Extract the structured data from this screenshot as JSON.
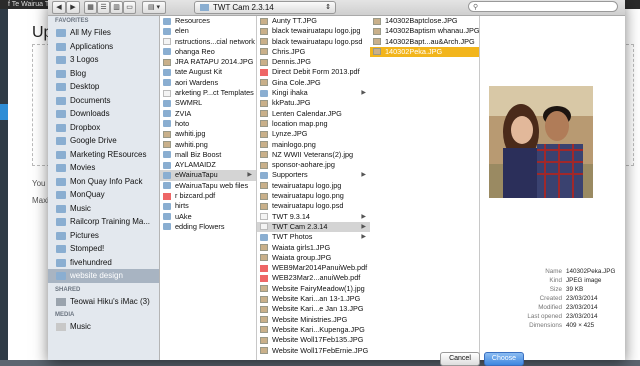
{
  "background": {
    "header": "f Te Wairua Ta",
    "title": "Up",
    "line1": "You a",
    "line2": "Maxi"
  },
  "toolbar": {
    "path_label": "TWT Cam 2.3.14",
    "search_placeholder": ""
  },
  "sidebar": {
    "favorites_header": "FAVORITES",
    "favorites": [
      "All My Files",
      "Applications",
      "3 Logos",
      "Blog",
      "Desktop",
      "Documents",
      "Downloads",
      "Dropbox",
      "Google Drive",
      "Marketing REsources",
      "Movies",
      "Mon Quay Info Pack",
      "MonQuay",
      "Music",
      "Railcorp Training Ma...",
      "Pictures",
      "Stomped!",
      "fivehundred",
      "website design"
    ],
    "shared_header": "SHARED",
    "shared": [
      "Teowai Hiku's iMac (3)"
    ],
    "media_header": "MEDIA",
    "media": [
      "Music"
    ]
  },
  "col1": [
    "Resources",
    "elen",
    "nstructions...cial network",
    "ohanga Reo",
    "JRA RATAPU 2014.JPG",
    "tate August Kit",
    "aori Wardens",
    "arketing P...ct Templates",
    "SWMRL",
    "ZVIA",
    "hoto",
    "awhiti.jpg",
    "awhiti.png",
    "mall Biz Boost",
    "AYLAMAIDZ",
    "eWairuaTapu",
    "eWairuaTapu web files",
    "r bizcard.pdf",
    "hirts",
    "uAke",
    "edding Flowers"
  ],
  "col2": [
    "Aunty TT.JPG",
    "black tewairuatapu logo.jpg",
    "black tewairuatapu logo.psd",
    "Chris.JPG",
    "Dennis.JPG",
    "Direct Debit Form 2013.pdf",
    "Gina Cole.JPG",
    "Kingi ihaka",
    "kkPatu.JPG",
    "Lenten Calendar.JPG",
    "location map.png",
    "Lynze.JPG",
    "mainlogo.png",
    "NZ WWII Veterans(2).jpg",
    "sponsor-aohare.jpg",
    "Supporters",
    "tewairuatapu logo.jpg",
    "tewairuatapu logo.png",
    "tewairuatapu logo.psd",
    "TWT 9.3.14",
    "TWT Cam 2.3.14",
    "TWT Photos",
    "Waiata girls1.JPG",
    "Waiata group.JPG",
    "WEB9Mar2014PanuiWeb.pdf",
    "WEB23Mar2...anuiWeb.pdf",
    "Website FairyMeadow(1).jpg",
    "Website Kari...an 13-1.JPG",
    "Website Kari...e Jan 13.JPG",
    "Website Ministries.JPG",
    "Website Kari...Kupenga.JPG",
    "Website Woll17Feb135.JPG",
    "Website Woll17FebErnie.JPG"
  ],
  "col3": [
    "140302Baptclose.JPG",
    "140302Baptism whanau.JPG",
    "140302Bapt...au&Arch.JPG",
    "140302Peka.JPG"
  ],
  "info": {
    "name_k": "Name",
    "name_v": "140302Peka.JPG",
    "kind_k": "Kind",
    "kind_v": "JPEG image",
    "size_k": "Size",
    "size_v": "39 KB",
    "created_k": "Created",
    "created_v": "23/03/2014",
    "modified_k": "Modified",
    "modified_v": "23/03/2014",
    "opened_k": "Last opened",
    "opened_v": "23/03/2014",
    "dims_k": "Dimensions",
    "dims_v": "409 × 425"
  },
  "buttons": {
    "cancel": "Cancel",
    "choose": "Choose"
  }
}
